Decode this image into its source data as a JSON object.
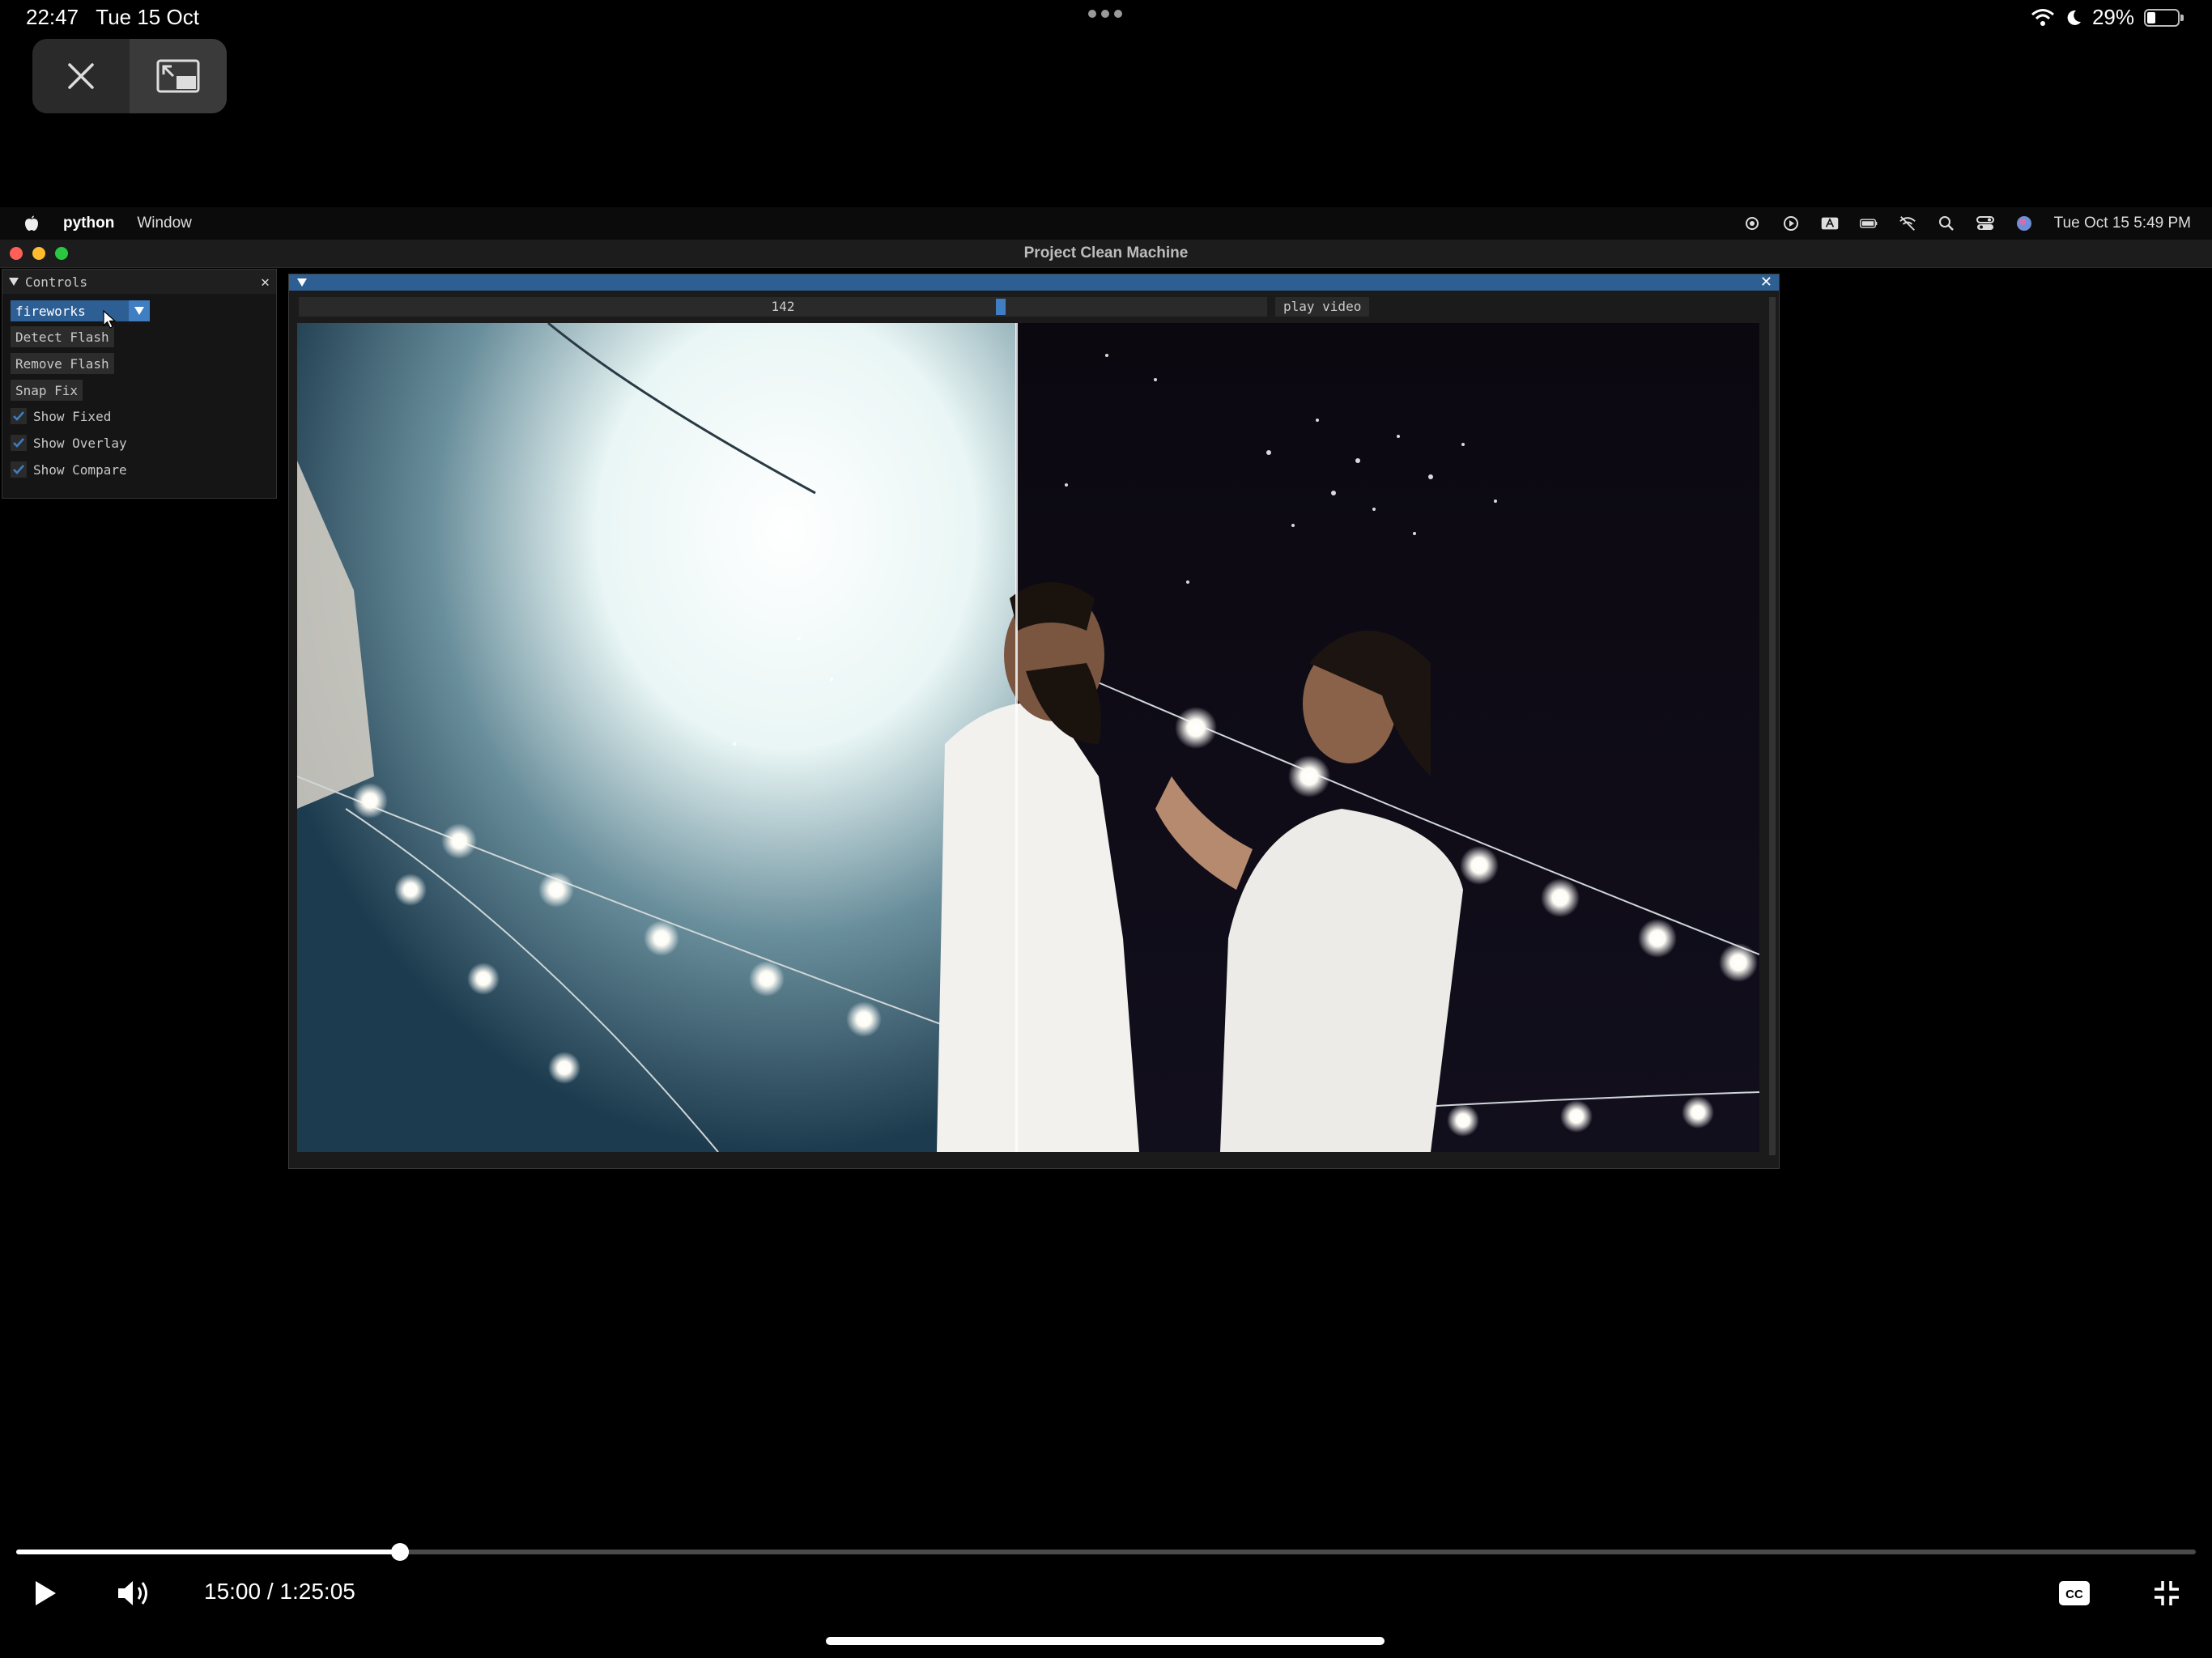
{
  "status_bar": {
    "time": "22:47",
    "date": "Tue 15 Oct",
    "battery": "29%",
    "battery_level": 0.29
  },
  "mac": {
    "app_name": "python",
    "menu_window": "Window",
    "clock": "Tue Oct 15  5:49 PM",
    "window_title": "Project Clean Machine"
  },
  "controls": {
    "title": "Controls",
    "preset": "fireworks",
    "buttons": {
      "detect": "Detect Flash",
      "remove": "Remove Flash",
      "snap": "Snap Fix"
    },
    "checks": {
      "fixed": "Show Fixed",
      "overlay": "Show Overlay",
      "compare": "Show Compare"
    }
  },
  "viewer": {
    "frame": "142",
    "frame_fraction": 0.72,
    "play_label": "play video"
  },
  "player": {
    "current": "15:00",
    "separator": "/",
    "duration": "1:25:05",
    "progress": 0.176
  },
  "colors": {
    "imgui_accent": "#2d5f95",
    "imgui_accent_light": "#3f7ec2"
  }
}
